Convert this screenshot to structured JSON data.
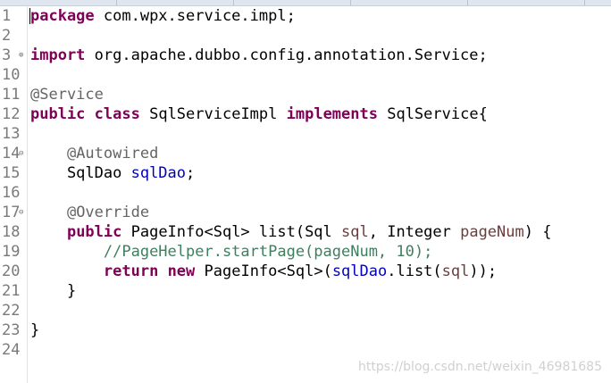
{
  "editor": {
    "lines": [
      {
        "num": "1",
        "fold": "",
        "segments": [
          [
            "kw",
            "package"
          ],
          [
            "txt",
            " com.wpx.service.impl;"
          ]
        ]
      },
      {
        "num": "2",
        "fold": "",
        "segments": []
      },
      {
        "num": "3",
        "fold": "⊕",
        "segments": [
          [
            "kw",
            "import"
          ],
          [
            "txt",
            " org.apache.dubbo.config.annotation.Service;"
          ]
        ]
      },
      {
        "num": "10",
        "fold": "",
        "segments": []
      },
      {
        "num": "11",
        "fold": "",
        "segments": [
          [
            "ann",
            "@Service"
          ]
        ]
      },
      {
        "num": "12",
        "fold": "",
        "segments": [
          [
            "kw",
            "public"
          ],
          [
            "txt",
            " "
          ],
          [
            "kw",
            "class"
          ],
          [
            "txt",
            " SqlServiceImpl "
          ],
          [
            "kw",
            "implements"
          ],
          [
            "txt",
            " SqlService{"
          ]
        ]
      },
      {
        "num": "13",
        "fold": "",
        "segments": []
      },
      {
        "num": "14",
        "fold": "⊖",
        "segments": [
          [
            "txt",
            "    "
          ],
          [
            "ann",
            "@Autowired"
          ]
        ]
      },
      {
        "num": "15",
        "fold": "",
        "segments": [
          [
            "txt",
            "    SqlDao "
          ],
          [
            "field",
            "sqlDao"
          ],
          [
            "txt",
            ";"
          ]
        ]
      },
      {
        "num": "16",
        "fold": "",
        "segments": []
      },
      {
        "num": "17",
        "fold": "⊖",
        "segments": [
          [
            "txt",
            "    "
          ],
          [
            "ann",
            "@Override"
          ]
        ]
      },
      {
        "num": "18",
        "fold": "",
        "segments": [
          [
            "txt",
            "    "
          ],
          [
            "kw",
            "public"
          ],
          [
            "txt",
            " PageInfo<Sql> list(Sql "
          ],
          [
            "param",
            "sql"
          ],
          [
            "txt",
            ", Integer "
          ],
          [
            "param",
            "pageNum"
          ],
          [
            "txt",
            ") {"
          ]
        ]
      },
      {
        "num": "19",
        "fold": "",
        "segments": [
          [
            "txt",
            "        "
          ],
          [
            "cmt",
            "//PageHelper.startPage(pageNum, 10);"
          ]
        ]
      },
      {
        "num": "20",
        "fold": "",
        "segments": [
          [
            "txt",
            "        "
          ],
          [
            "kw",
            "return"
          ],
          [
            "txt",
            " "
          ],
          [
            "kw",
            "new"
          ],
          [
            "txt",
            " PageInfo<Sql>("
          ],
          [
            "field",
            "sqlDao"
          ],
          [
            "txt",
            ".list("
          ],
          [
            "param",
            "sql"
          ],
          [
            "txt",
            "));"
          ]
        ]
      },
      {
        "num": "21",
        "fold": "",
        "segments": [
          [
            "txt",
            "    }"
          ]
        ]
      },
      {
        "num": "22",
        "fold": "",
        "segments": []
      },
      {
        "num": "23",
        "fold": "",
        "segments": [
          [
            "txt",
            "}"
          ]
        ]
      },
      {
        "num": "24",
        "fold": "",
        "segments": []
      }
    ]
  },
  "watermark": "https://blog.csdn.net/weixin_46981685",
  "colors": {
    "keyword": "#7f0055",
    "annotation": "#646464",
    "field": "#0000c0",
    "parameter": "#6a3e3e",
    "comment": "#3f7f5f",
    "line_number": "#7a7a7a"
  }
}
